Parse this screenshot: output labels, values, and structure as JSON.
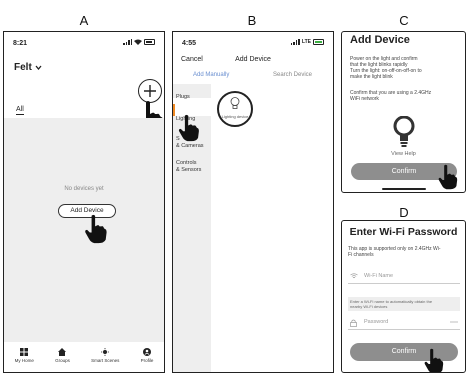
{
  "panel_labels": [
    "A",
    "B",
    "C",
    "D"
  ],
  "panel_a": {
    "time": "8:21",
    "home_title": "Felt",
    "tab_all": "All",
    "empty_text": "No devices yet",
    "add_device_button": "Add Device",
    "nav": [
      {
        "label": "My Home",
        "icon": "grid-icon"
      },
      {
        "label": "Groups",
        "icon": "house-icon"
      },
      {
        "label": "Smart Scenes",
        "icon": "sun-icon"
      },
      {
        "label": "Profile",
        "icon": "profile-icon"
      }
    ]
  },
  "panel_b": {
    "time": "4:55",
    "network": "LTE",
    "cancel": "Cancel",
    "title": "Add Device",
    "tab_manual": "Add Manually",
    "tab_search": "Search Device",
    "categories": [
      "Plugs",
      "Lighting",
      "S... & Cameras",
      "Controls & Sensors"
    ],
    "categories_display": [
      "Plugs",
      "Lighting",
      "S",
      "& Cameras",
      "Controls",
      "& Sensors"
    ],
    "tile_label": "Lighting device"
  },
  "panel_c": {
    "title": "Add Device",
    "instructions": [
      "Power on the light and confirm",
      "that the light blinks rapidly",
      "Turn the light: on-off-on-off-on to",
      "make the light blink"
    ],
    "wifi_note": [
      "Confirm that you are using a 2.4GHz",
      "WiFi network"
    ],
    "view_help": "View Help",
    "confirm": "Confirm"
  },
  "panel_d": {
    "title": "Enter Wi-Fi Password",
    "note": [
      "This app is supported only on 2.4GHz Wi-",
      "Fi channels"
    ],
    "wifi_name_placeholder": "Wi-Fi Name",
    "hint": [
      "Enter a Wi-Fi name to automatically obtain the",
      "nearby Wi-Fi devices"
    ],
    "password_placeholder": "Password",
    "confirm": "Confirm"
  },
  "colors": {
    "gray_bg": "#eeeeee",
    "button_gray": "#8e8e8e",
    "accent_orange": "#f08a24"
  }
}
